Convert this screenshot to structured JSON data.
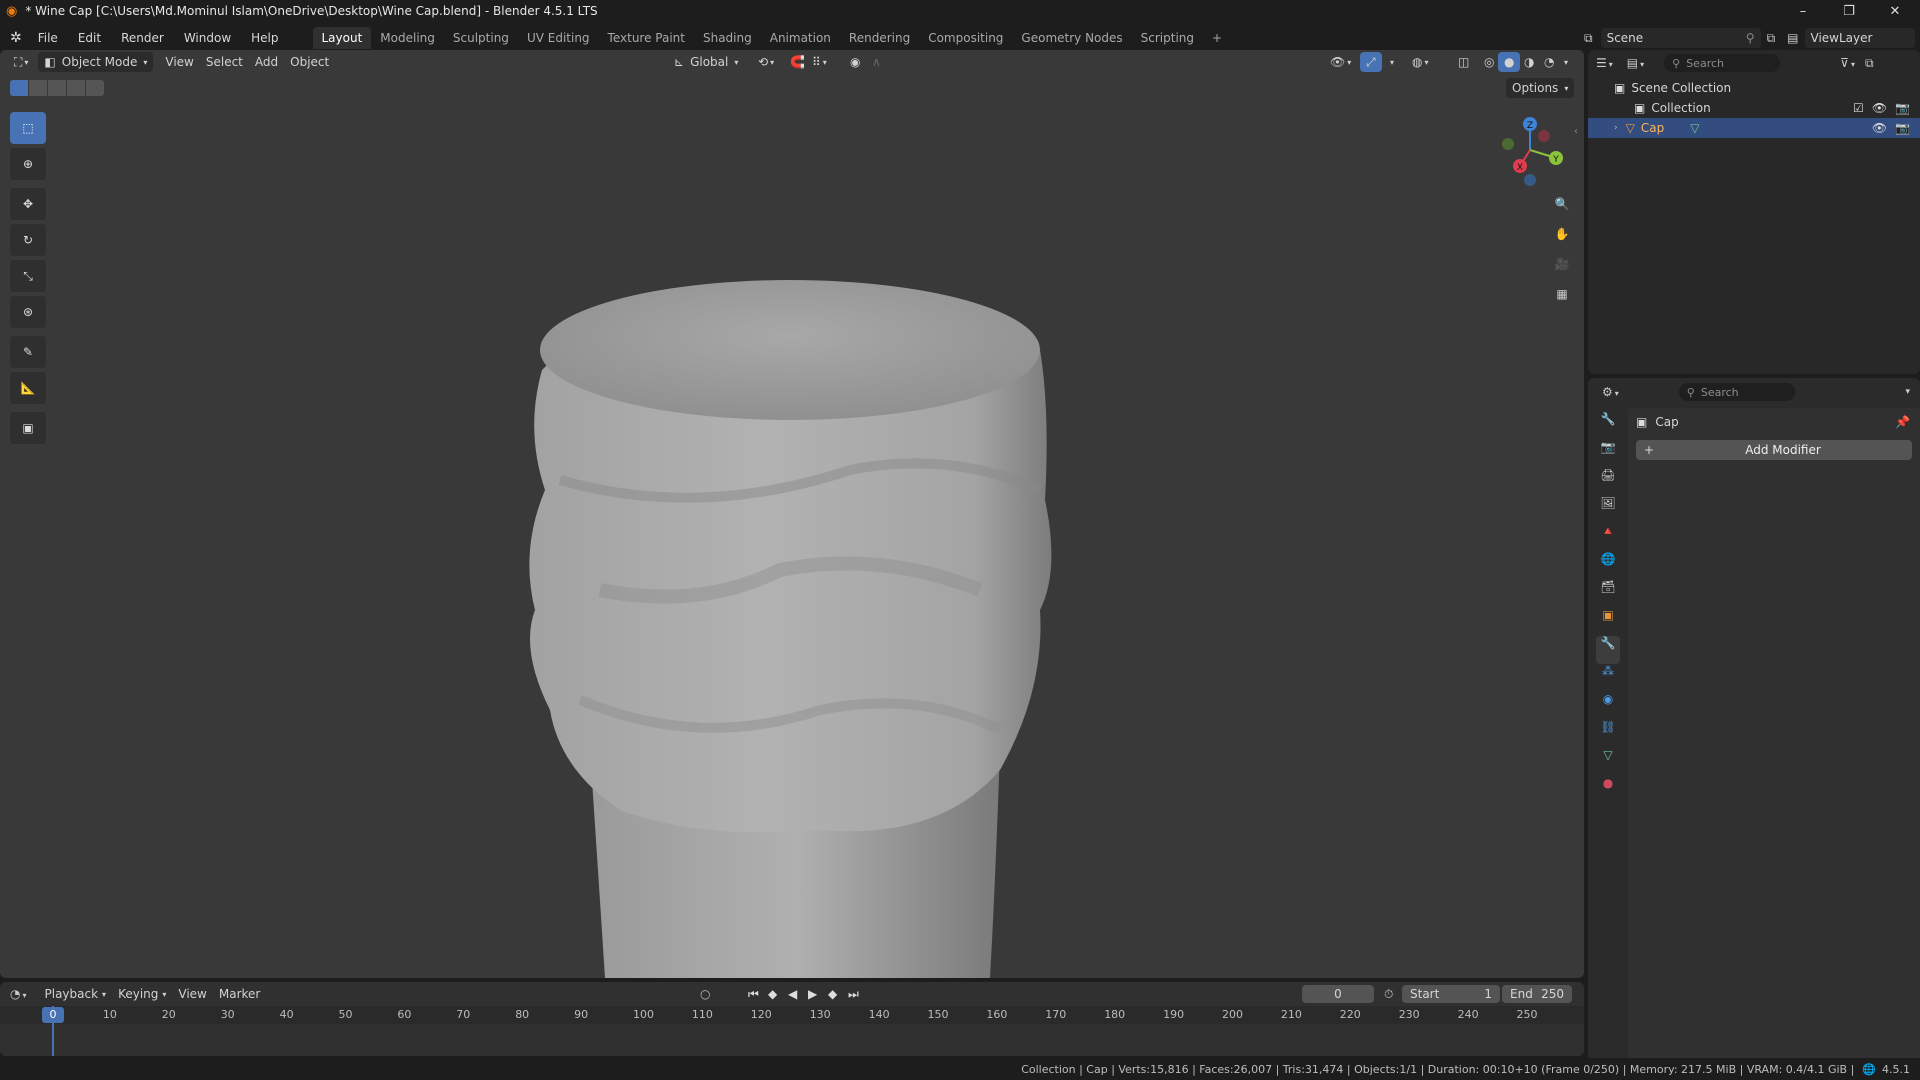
{
  "window": {
    "title": "* Wine Cap [C:\\Users\\Md.Mominul Islam\\OneDrive\\Desktop\\Wine Cap.blend] - Blender 4.5.1 LTS",
    "minimize": "–",
    "maximize": "❐",
    "close": "✕"
  },
  "menu": [
    "File",
    "Edit",
    "Render",
    "Window",
    "Help"
  ],
  "workspaces": [
    "Layout",
    "Modeling",
    "Sculpting",
    "UV Editing",
    "Texture Paint",
    "Shading",
    "Animation",
    "Rendering",
    "Compositing",
    "Geometry Nodes",
    "Scripting"
  ],
  "workspace_add": "+",
  "scene": {
    "label": "Scene",
    "viewlayer": "ViewLayer"
  },
  "viewport": {
    "mode": "Object Mode",
    "menus": [
      "View",
      "Select",
      "Add",
      "Object"
    ],
    "orientation": "Global",
    "options": "Options",
    "gizmo": {
      "x": "X",
      "y": "Y",
      "z": "Z"
    }
  },
  "outliner": {
    "search_placeholder": "Search",
    "scene_collection": "Scene Collection",
    "collection": "Collection",
    "object": "Cap"
  },
  "properties": {
    "search_placeholder": "Search",
    "object_name": "Cap",
    "add_modifier": "Add Modifier"
  },
  "timeline": {
    "menus": [
      "Playback",
      "Keying",
      "View",
      "Marker"
    ],
    "current_frame": "0",
    "start_label": "Start",
    "start": "1",
    "end_label": "End",
    "end": "250",
    "ruler": [
      "0",
      "10",
      "20",
      "30",
      "40",
      "50",
      "60",
      "70",
      "80",
      "90",
      "100",
      "110",
      "120",
      "130",
      "140",
      "150",
      "160",
      "170",
      "180",
      "190",
      "200",
      "210",
      "220",
      "230",
      "240",
      "250"
    ]
  },
  "status": {
    "text": "Collection | Cap | Verts:15,816 | Faces:26,007 | Tris:31,474 | Objects:1/1 | Duration: 00:10+10 (Frame 0/250) | Memory: 217.5 MiB | VRAM: 0.4/4.1 GiB |",
    "version": "4.5.1"
  },
  "colors": {
    "accent": "#4772b3",
    "selected_row": "#334d80",
    "axis_x": "#e03c4f",
    "axis_y": "#8bc33a",
    "axis_z": "#3f84d8"
  }
}
